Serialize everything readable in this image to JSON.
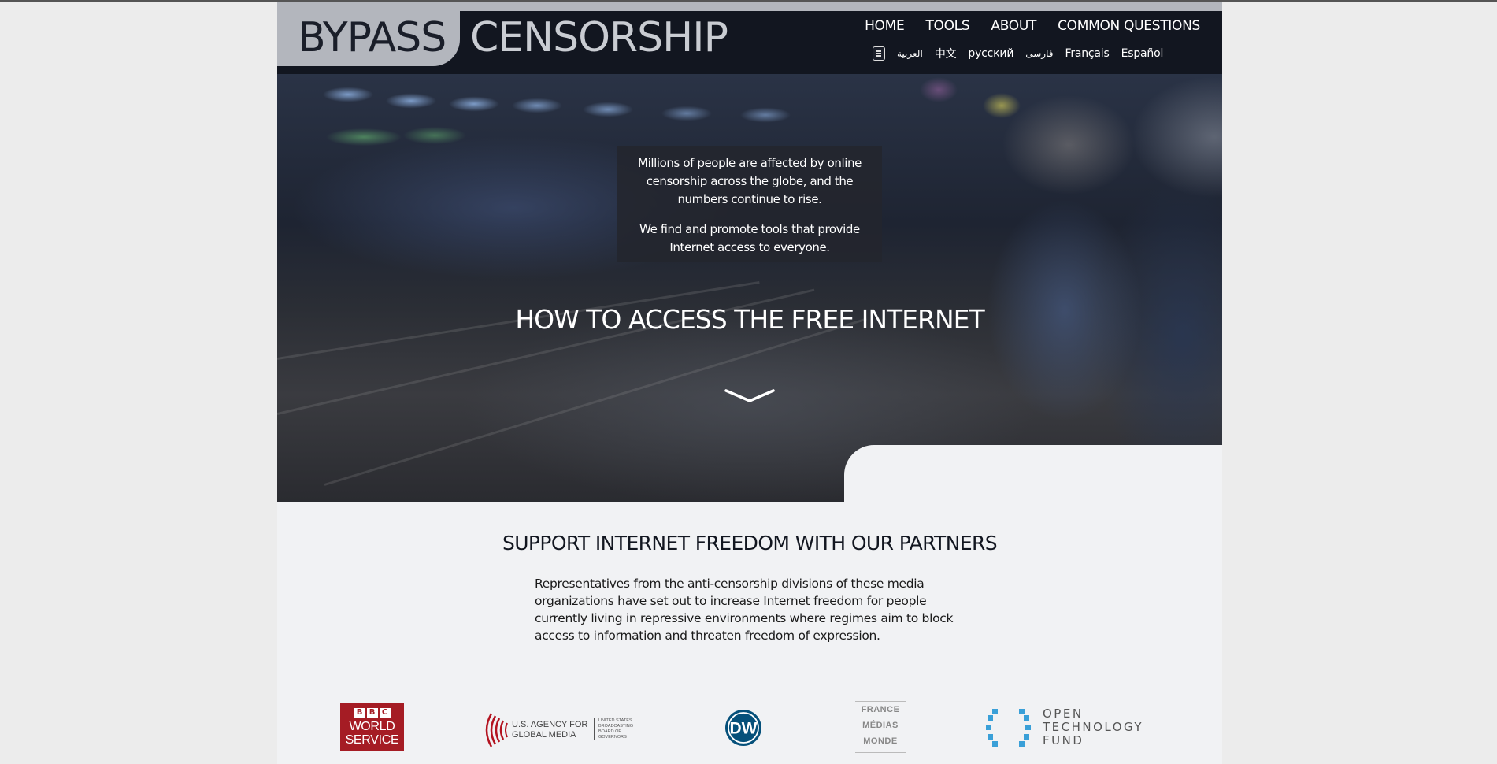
{
  "header": {
    "logo_part1": "BYPASS",
    "logo_part2": "CENSORSHIP",
    "nav": [
      "HOME",
      "TOOLS",
      "ABOUT",
      "COMMON QUESTIONS"
    ],
    "languages": [
      "العربية",
      "中文",
      "русский",
      "فارسی",
      "Français",
      "Español"
    ],
    "language_icon": "translate-icon"
  },
  "hero": {
    "intro_p1": "Millions of people are affected by online censorship across the globe, and the numbers continue to rise.",
    "intro_p2": "We find and promote tools that provide Internet access to everyone.",
    "title": "HOW TO ACCESS THE FREE INTERNET",
    "scroll_icon": "chevron-down-icon"
  },
  "partners": {
    "title": "SUPPORT INTERNET FREEDOM WITH OUR PARTNERS",
    "description": "Representatives from the anti-censorship divisions of these media organizations have set out to increase Internet freedom for people currently living in repressive environments where regimes aim to block access to information and threaten freedom of expression.",
    "bbc": {
      "blocks": [
        "B",
        "B",
        "C"
      ],
      "line1": "WORLD",
      "line2": "SERVICE"
    },
    "usagm": {
      "line1": "U.S. AGENCY FOR",
      "line2": "GLOBAL MEDIA",
      "sub": [
        "UNITED STATES",
        "BROADCASTING",
        "BOARD OF",
        "GOVERNORS"
      ]
    },
    "dw": {
      "text": "DW"
    },
    "fmm": {
      "line1": "FRANCE",
      "line2": "MÉDIAS",
      "line3": "MONDE"
    },
    "otf": {
      "line1": "OPEN",
      "line2": "TECHNOLOGY",
      "line3": "FUND"
    }
  },
  "colors": {
    "header_bg": "#121620",
    "page_bg": "#f1f2f4",
    "bbc_red": "#a51c24",
    "usagm_red": "#b3121f",
    "dw_blue": "#05507a",
    "otf_blue": "#3aa0d8"
  }
}
